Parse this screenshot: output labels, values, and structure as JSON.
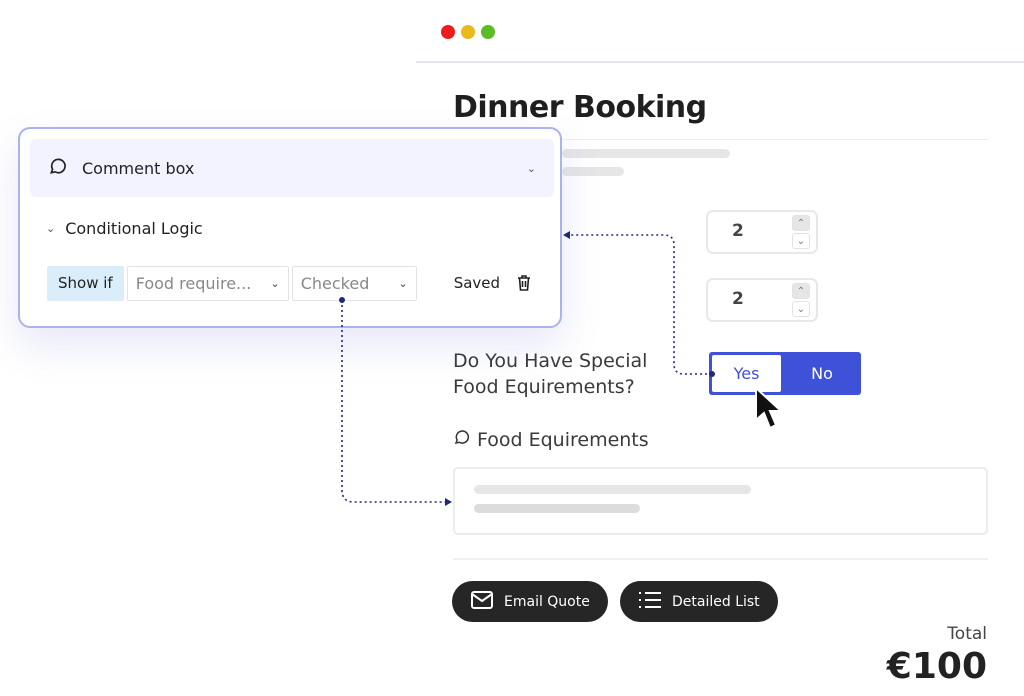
{
  "window": {
    "traffic_lights": [
      "#ee1d1d",
      "#ecb91b",
      "#5cbc23"
    ]
  },
  "form": {
    "title": "Dinner Booking",
    "steppers": [
      {
        "value": "2",
        "up_icon": "chevron-up-icon",
        "down_icon": "chevron-down-icon"
      },
      {
        "value": "2",
        "up_icon": "chevron-up-icon",
        "down_icon": "chevron-down-icon"
      }
    ],
    "question_line1": "Do You Have Special",
    "question_line2": "Food Equirements?",
    "toggle": {
      "yes": "Yes",
      "no": "No",
      "selected": "Yes",
      "accent": "#3f51d9"
    },
    "comment_field_label": "Food Equirements",
    "buttons": {
      "email_quote": "Email Quote",
      "detailed_list": "Detailed List"
    },
    "total_label": "Total",
    "total_value": "€100"
  },
  "panel": {
    "header_title": "Comment box",
    "conditional_logic_label": "Conditional Logic",
    "rule": {
      "show_if": "Show if",
      "field_select": "Food require...",
      "state_select": "Checked",
      "status": "Saved"
    },
    "accent": "#a9b3ec"
  },
  "connector_color": "#1e2a78"
}
